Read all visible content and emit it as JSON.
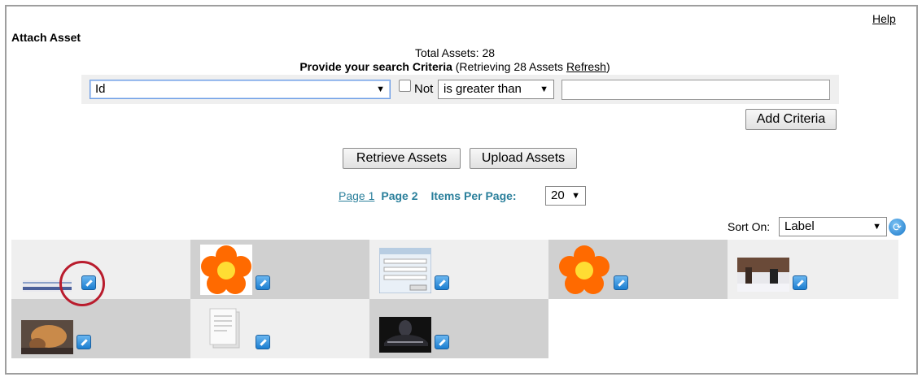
{
  "header": {
    "help_label": "Help",
    "title": "Attach Asset"
  },
  "summary": {
    "total_text": "Total Assets: 28",
    "criteria_bold": "Provide your search Criteria",
    "criteria_prefix": " (Retrieving 28 Assets ",
    "refresh_label": "Refresh",
    "criteria_suffix": ")"
  },
  "criteria": {
    "field_value": "Id",
    "not_label": "Not",
    "not_checked": false,
    "operator_value": "is greater than",
    "value": "",
    "add_label": "Add Criteria"
  },
  "actions": {
    "retrieve_label": "Retrieve Assets",
    "upload_label": "Upload Assets"
  },
  "pagination": {
    "page1": "Page 1",
    "page2": "Page 2",
    "items_per_page_label": "Items Per Page:",
    "items_per_page_value": "20"
  },
  "sort": {
    "label": "Sort On:",
    "value": "Label"
  },
  "assets": [
    {
      "thumb": "screenshot-strip",
      "selected": false
    },
    {
      "thumb": "orange-flower",
      "selected": true
    },
    {
      "thumb": "dialog-screenshot",
      "selected": false
    },
    {
      "thumb": "orange-flower",
      "selected": false
    },
    {
      "thumb": "snow-photo",
      "selected": false
    },
    {
      "thumb": "dog-photo",
      "selected": false
    },
    {
      "thumb": "document",
      "selected": false
    },
    {
      "thumb": "car-photo",
      "selected": false
    }
  ],
  "colors": {
    "link": "#2a7f9b",
    "highlight_circle": "#b91c2d",
    "edit_icon": "#1c7ed0"
  }
}
